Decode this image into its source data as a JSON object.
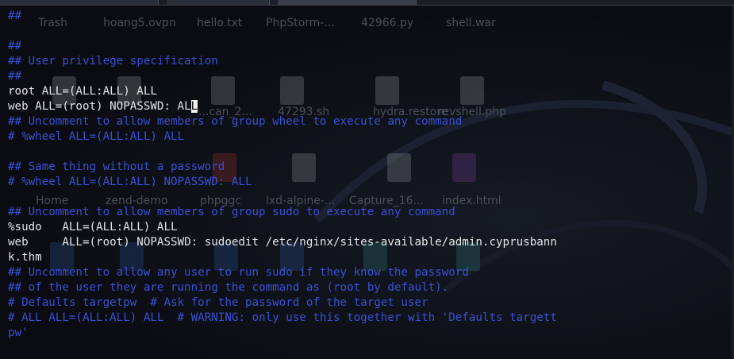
{
  "desktop": {
    "icons": [
      {
        "label": "Trash",
        "color": "#7c8088"
      },
      {
        "label": "hoang5.ovpn",
        "color": "#7c8088"
      },
      {
        "label": "hello.txt",
        "color": "#7c8088"
      },
      {
        "label": "PhpStorm-...",
        "color": "#7c8088"
      },
      {
        "label": "42966.py",
        "color": "#7c8088"
      },
      {
        "label": "shell.war",
        "color": "#7c8088"
      },
      {
        "label": "...can_2...",
        "color": "#8a2a2a"
      },
      {
        "label": "47293.sh",
        "color": "#7c8088"
      },
      {
        "label": "hydra.restore",
        "color": "#7c8088"
      },
      {
        "label": "revshell.php",
        "color": "#6a3a8a"
      },
      {
        "label": "Home",
        "color": "#2a4a8a"
      },
      {
        "label": "zend-demo",
        "color": "#2a4a8a"
      },
      {
        "label": "phpggc",
        "color": "#2a4a8a"
      },
      {
        "label": "lxd-alpine-...",
        "color": "#2a4a8a"
      },
      {
        "label": "Capture_16...",
        "color": "#2a6a6a"
      },
      {
        "label": "index.html",
        "color": "#2a6a6a"
      }
    ]
  },
  "terminal": {
    "lines": [
      {
        "text": "##",
        "kind": "comment"
      },
      {
        "text": "",
        "kind": "normal"
      },
      {
        "text": "##",
        "kind": "comment"
      },
      {
        "text": "## User privilege specification",
        "kind": "comment"
      },
      {
        "text": "##",
        "kind": "comment"
      },
      {
        "text": "root ALL=(ALL:ALL) ALL",
        "kind": "normal"
      },
      {
        "text": "web ALL=(root) NOPASSWD: AL",
        "kind": "normal",
        "cursor_char": "L"
      },
      {
        "text": "## Uncomment to allow members of group wheel to execute any command",
        "kind": "comment"
      },
      {
        "text": "# %wheel ALL=(ALL:ALL) ALL",
        "kind": "comment"
      },
      {
        "text": "",
        "kind": "normal"
      },
      {
        "text": "## Same thing without a password",
        "kind": "comment"
      },
      {
        "text": "# %wheel ALL=(ALL:ALL) NOPASSWD: ALL",
        "kind": "comment"
      },
      {
        "text": "",
        "kind": "normal"
      },
      {
        "text": "## Uncomment to allow members of group sudo to execute any command",
        "kind": "comment"
      },
      {
        "text": "%sudo   ALL=(ALL:ALL) ALL",
        "kind": "normal"
      },
      {
        "text": "web     ALL=(root) NOPASSWD: sudoedit /etc/nginx/sites-available/admin.cyprusbann",
        "kind": "normal"
      },
      {
        "text": "k.thm",
        "kind": "normal"
      },
      {
        "text": "## Uncomment to allow any user to run sudo if they know the password",
        "kind": "comment"
      },
      {
        "text": "## of the user they are running the command as (root by default).",
        "kind": "comment"
      },
      {
        "text": "# Defaults targetpw  # Ask for the password of the target user",
        "kind": "comment"
      },
      {
        "text": "# ALL ALL=(ALL:ALL) ALL  # WARNING: only use this together with 'Defaults targett",
        "kind": "comment"
      },
      {
        "text": "pw'",
        "kind": "comment"
      }
    ]
  },
  "colors": {
    "comment": "#3b4fd6",
    "text": "#e4e4e4",
    "background": "#0b0d12"
  }
}
